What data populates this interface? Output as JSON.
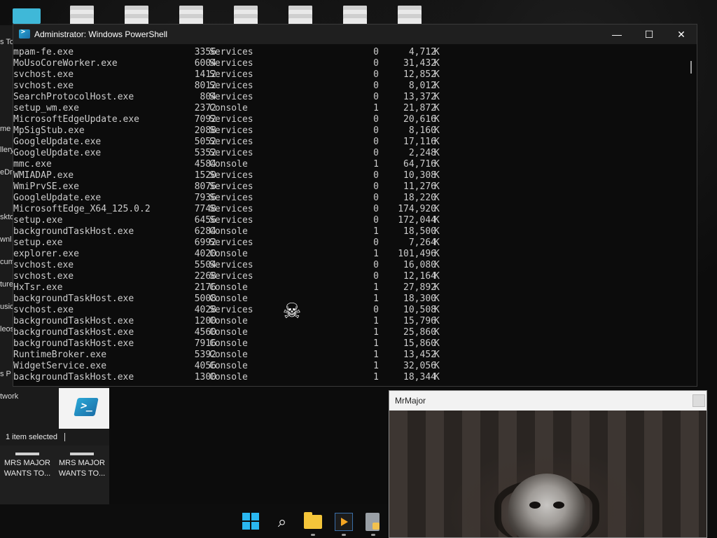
{
  "ps_window": {
    "title": "Administrator: Windows PowerShell",
    "minimize": "—",
    "maximize": "☐",
    "close": "✕"
  },
  "processes": [
    {
      "name": "mpam-fe.exe",
      "pid": "3356",
      "session": "Services",
      "num": "0",
      "mem": "4,712",
      "unit": "K"
    },
    {
      "name": "MoUsoCoreWorker.exe",
      "pid": "6004",
      "session": "Services",
      "num": "0",
      "mem": "31,432",
      "unit": "K"
    },
    {
      "name": "svchost.exe",
      "pid": "1412",
      "session": "Services",
      "num": "0",
      "mem": "12,852",
      "unit": "K"
    },
    {
      "name": "svchost.exe",
      "pid": "8012",
      "session": "Services",
      "num": "0",
      "mem": "8,012",
      "unit": "K"
    },
    {
      "name": "SearchProtocolHost.exe",
      "pid": "804",
      "session": "Services",
      "num": "0",
      "mem": "13,372",
      "unit": "K"
    },
    {
      "name": "setup_wm.exe",
      "pid": "2372",
      "session": "Console",
      "num": "1",
      "mem": "21,872",
      "unit": "K"
    },
    {
      "name": "MicrosoftEdgeUpdate.exe",
      "pid": "7092",
      "session": "Services",
      "num": "0",
      "mem": "20,616",
      "unit": "K"
    },
    {
      "name": "MpSigStub.exe",
      "pid": "2088",
      "session": "Services",
      "num": "0",
      "mem": "8,160",
      "unit": "K"
    },
    {
      "name": "GoogleUpdate.exe",
      "pid": "5052",
      "session": "Services",
      "num": "0",
      "mem": "17,116",
      "unit": "K"
    },
    {
      "name": "GoogleUpdate.exe",
      "pid": "5352",
      "session": "Services",
      "num": "0",
      "mem": "2,248",
      "unit": "K"
    },
    {
      "name": "mmc.exe",
      "pid": "4584",
      "session": "Console",
      "num": "1",
      "mem": "64,716",
      "unit": "K"
    },
    {
      "name": "WMIADAP.exe",
      "pid": "1520",
      "session": "Services",
      "num": "0",
      "mem": "10,308",
      "unit": "K"
    },
    {
      "name": "WmiPrvSE.exe",
      "pid": "8076",
      "session": "Services",
      "num": "0",
      "mem": "11,276",
      "unit": "K"
    },
    {
      "name": "GoogleUpdate.exe",
      "pid": "7936",
      "session": "Services",
      "num": "0",
      "mem": "18,220",
      "unit": "K"
    },
    {
      "name": "MicrosoftEdge_X64_125.0.2",
      "pid": "7748",
      "session": "Services",
      "num": "0",
      "mem": "174,920",
      "unit": "K"
    },
    {
      "name": "setup.exe",
      "pid": "6456",
      "session": "Services",
      "num": "0",
      "mem": "172,044",
      "unit": "K"
    },
    {
      "name": "backgroundTaskHost.exe",
      "pid": "6284",
      "session": "Console",
      "num": "1",
      "mem": "18,500",
      "unit": "K"
    },
    {
      "name": "setup.exe",
      "pid": "6992",
      "session": "Services",
      "num": "0",
      "mem": "7,264",
      "unit": "K"
    },
    {
      "name": "explorer.exe",
      "pid": "4020",
      "session": "Console",
      "num": "1",
      "mem": "101,496",
      "unit": "K"
    },
    {
      "name": "svchost.exe",
      "pid": "5504",
      "session": "Services",
      "num": "0",
      "mem": "16,080",
      "unit": "K"
    },
    {
      "name": "svchost.exe",
      "pid": "2268",
      "session": "Services",
      "num": "0",
      "mem": "12,164",
      "unit": "K"
    },
    {
      "name": "HxTsr.exe",
      "pid": "2176",
      "session": "Console",
      "num": "1",
      "mem": "27,892",
      "unit": "K"
    },
    {
      "name": "backgroundTaskHost.exe",
      "pid": "5008",
      "session": "Console",
      "num": "1",
      "mem": "18,300",
      "unit": "K"
    },
    {
      "name": "svchost.exe",
      "pid": "4028",
      "session": "Services",
      "num": "0",
      "mem": "10,508",
      "unit": "K"
    },
    {
      "name": "backgroundTaskHost.exe",
      "pid": "1200",
      "session": "Console",
      "num": "1",
      "mem": "15,796",
      "unit": "K"
    },
    {
      "name": "backgroundTaskHost.exe",
      "pid": "4560",
      "session": "Console",
      "num": "1",
      "mem": "25,860",
      "unit": "K"
    },
    {
      "name": "backgroundTaskHost.exe",
      "pid": "7916",
      "session": "Console",
      "num": "1",
      "mem": "15,860",
      "unit": "K"
    },
    {
      "name": "RuntimeBroker.exe",
      "pid": "5392",
      "session": "Console",
      "num": "1",
      "mem": "13,452",
      "unit": "K"
    },
    {
      "name": "WidgetService.exe",
      "pid": "4056",
      "session": "Console",
      "num": "1",
      "mem": "32,056",
      "unit": "K"
    },
    {
      "name": "backgroundTaskHost.exe",
      "pid": "1300",
      "session": "Console",
      "num": "1",
      "mem": "18,344",
      "unit": "K"
    }
  ],
  "cursor_icon": "skull-crossbones-icon",
  "cursor_glyph": "☠",
  "explorer": {
    "nav_items": [
      "s To",
      "me",
      "llery",
      "eDr",
      "skto",
      "wnl",
      "cum",
      "ture",
      "usic",
      "leos",
      "s P",
      "twork"
    ],
    "status_text": "1 item selected",
    "bottom_files": [
      {
        "label_line1": "MRS MAJOR",
        "label_line2": "WANTS TO..."
      },
      {
        "label_line1": "MRS MAJOR",
        "label_line2": "WANTS TO..."
      }
    ],
    "ps_thumb_glyph": ">_"
  },
  "mrmajor_window": {
    "title": "MrMajor"
  },
  "taskbar": {
    "search_glyph": "⌕"
  },
  "colors": {
    "console_bg": "#0c0c0c",
    "console_fg": "#cccccc",
    "titlebar": "#1f1f1f",
    "accent_blue": "#2ab7f0"
  }
}
